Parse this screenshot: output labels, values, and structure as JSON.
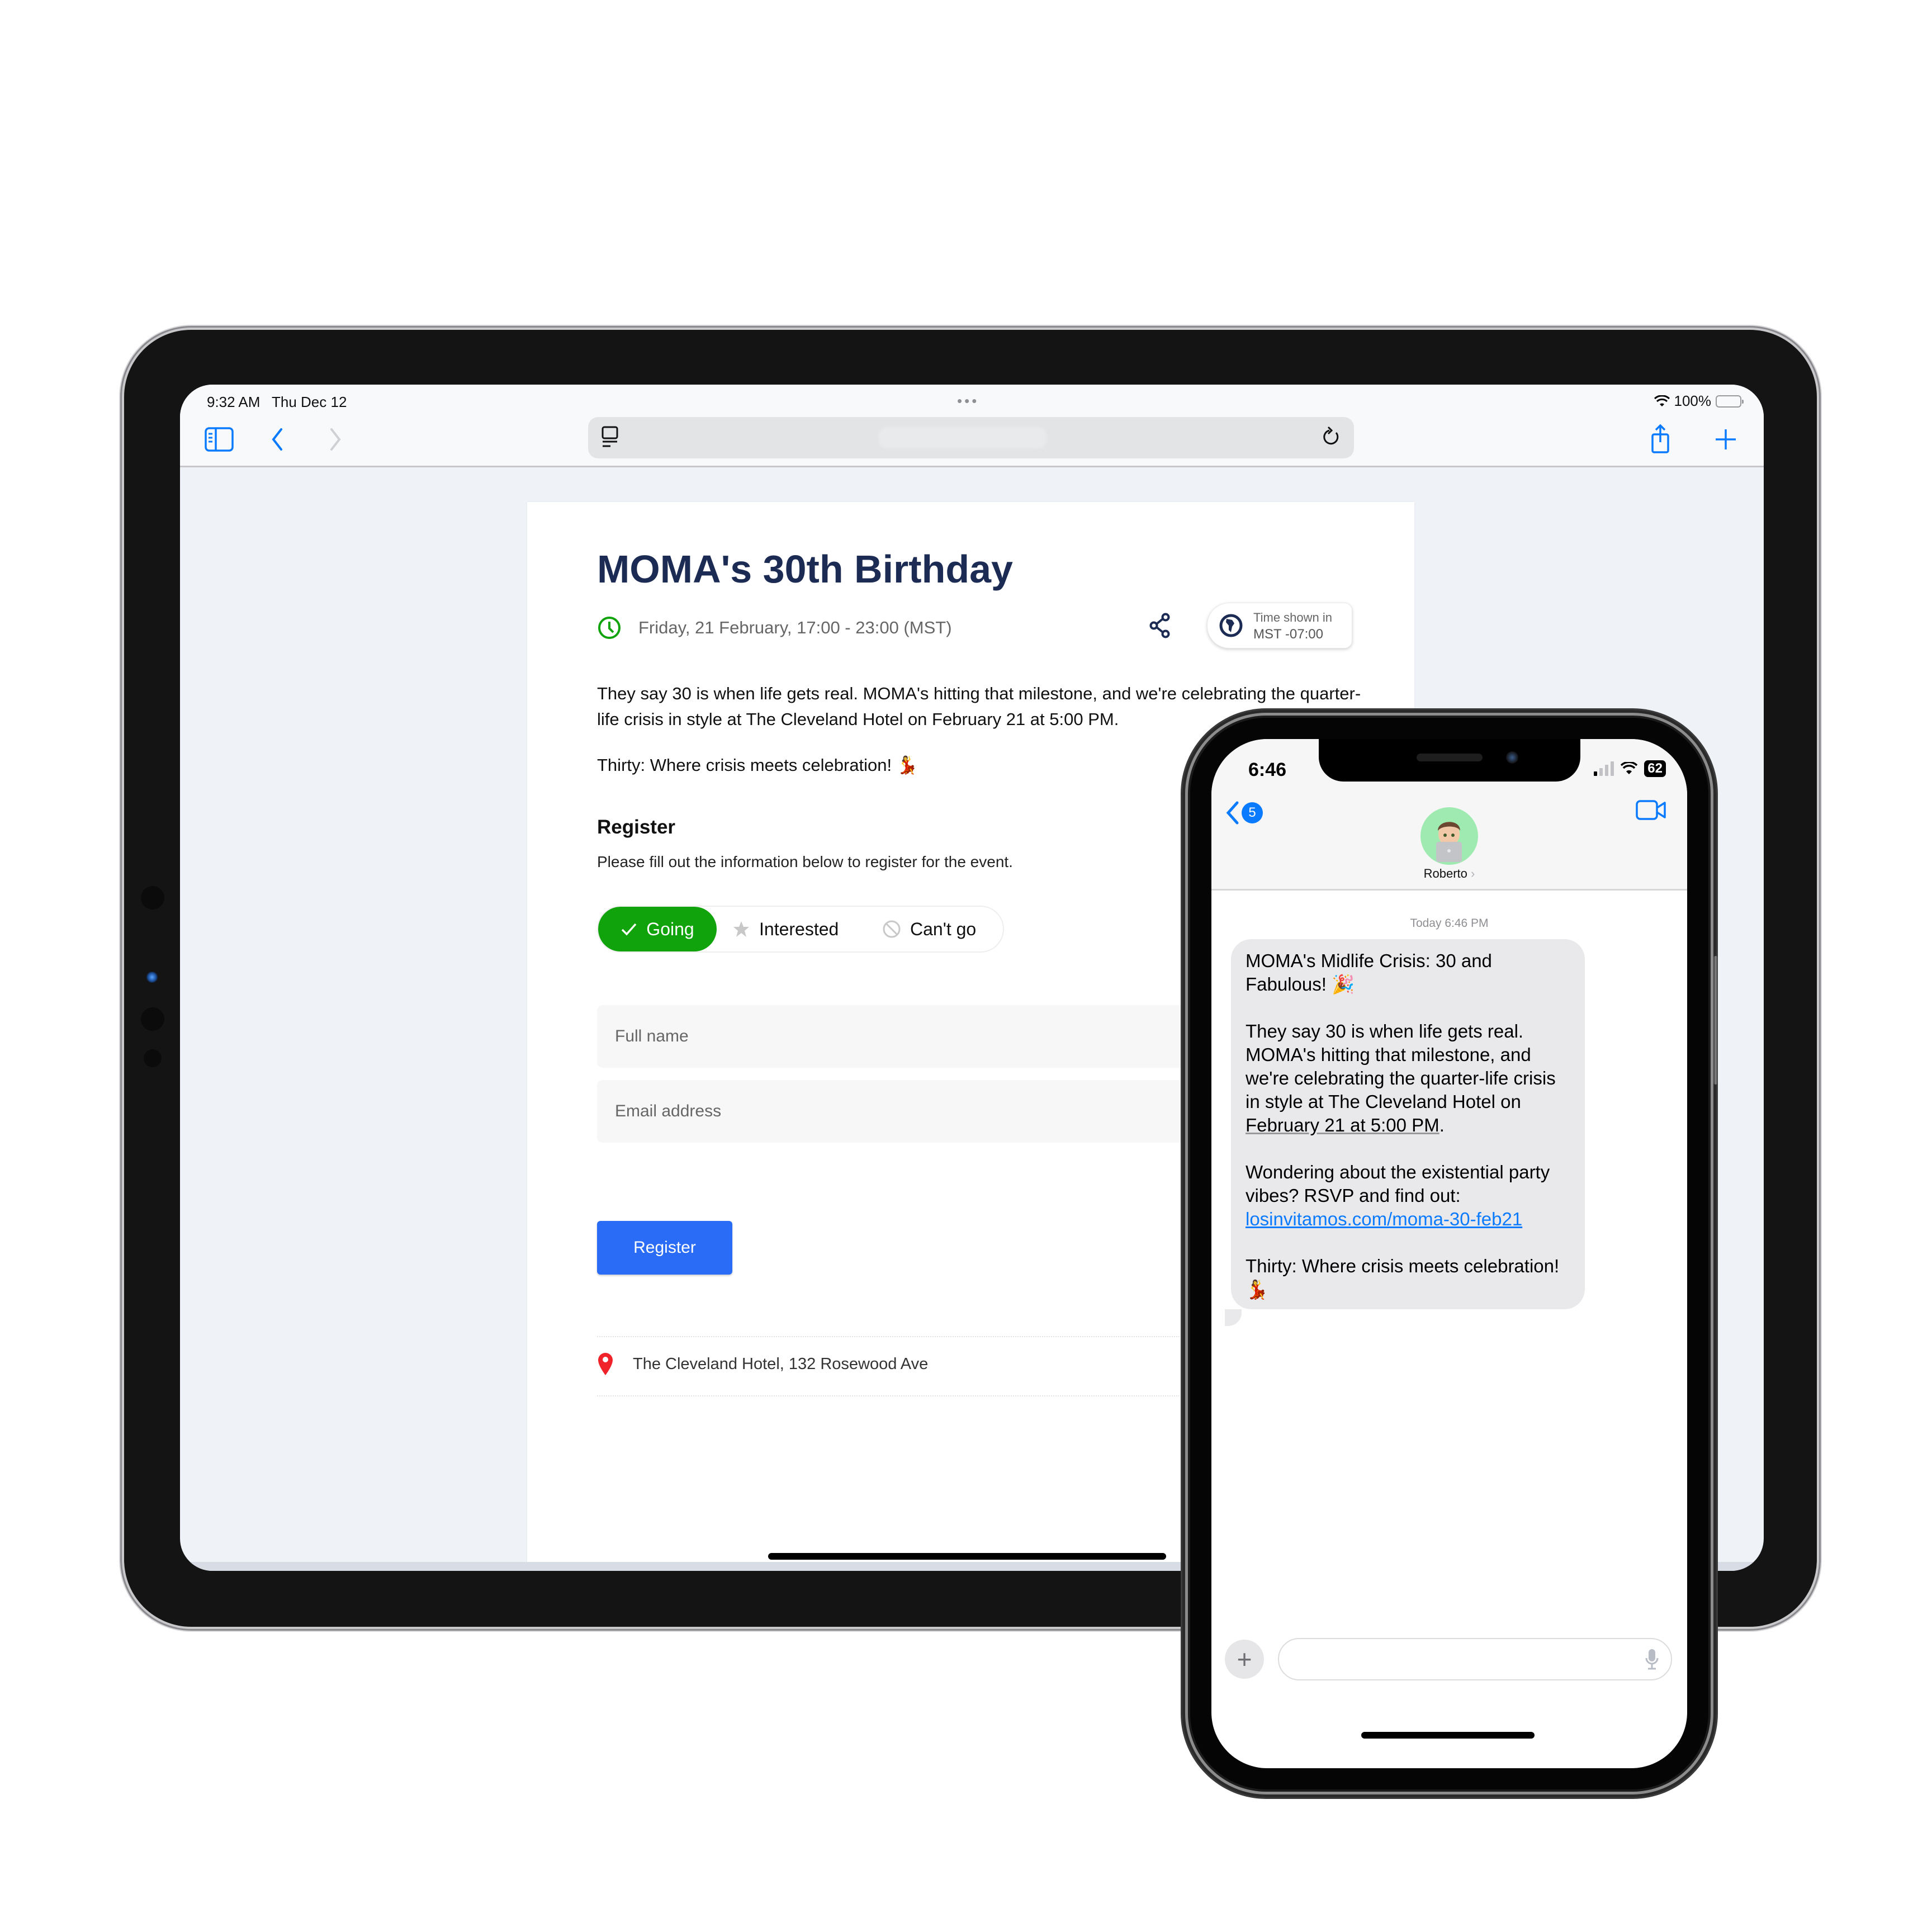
{
  "ipad": {
    "status": {
      "time": "9:32 AM",
      "date": "Thu Dec 12",
      "battery": "100%",
      "battery_level": 1.0
    },
    "toolbar": {
      "sidebar_icon": "sidebar-icon",
      "back_icon": "chevron-left-icon",
      "forward_icon": "chevron-right-icon",
      "reader_icon": "reader-mode-icon",
      "reload_icon": "reload-icon",
      "share_icon": "share-icon",
      "new_tab_icon": "plus-icon",
      "tabs_icon": "tabs-icon"
    },
    "event": {
      "title": "MOMA's 30th Birthday",
      "datetime": "Friday, 21 February, 17:00 - 23:00 (MST)",
      "timezone_label": "Time shown in",
      "timezone_value": "MST -07:00",
      "description": "They say 30 is when life gets real. MOMA's hitting that milestone, and we're celebrating the quarter-life crisis in style at The Cleveland Hotel on February 21 at 5:00 PM.",
      "tagline": "Thirty: Where crisis meets celebration! 💃",
      "register_heading": "Register",
      "register_subtitle": "Please fill out the information below to register for the event.",
      "rsvp_options": [
        {
          "label": "Going",
          "icon": "check-icon",
          "selected": true
        },
        {
          "label": "Interested",
          "icon": "star-icon",
          "selected": false
        },
        {
          "label": "Can't go",
          "icon": "prohibited-icon",
          "selected": false
        }
      ],
      "fields": {
        "full_name_placeholder": "Full name",
        "email_placeholder": "Email address"
      },
      "register_button": "Register",
      "location": "The Cleveland Hotel, 132 Rosewood Ave"
    },
    "colors": {
      "accent_green": "#11a30c",
      "button_blue": "#2b6cf6",
      "title_navy": "#1c2b53",
      "location_red": "#f0222a"
    }
  },
  "iphone": {
    "status": {
      "time": "6:46",
      "battery": "62"
    },
    "header": {
      "unread_count": "5",
      "contact_name": "Roberto",
      "contact_chevron": "›"
    },
    "timestamp": "Today 6:46 PM",
    "message": {
      "line1": "MOMA's Midlife Crisis: 30 and Fabulous! 🎉",
      "para2_before": "They say 30 is when life gets real. MOMA's hitting that milestone, and we're celebrating the quarter-life crisis in style at The Cleveland Hotel on ",
      "para2_date": "February 21 at 5:00 PM",
      "para2_after": ".",
      "para3": "Wondering about the existential party vibes? RSVP and find out:",
      "link": "losinvitamos.com/moma-30-feb21",
      "para4": "Thirty: Where crisis meets celebration! 💃"
    },
    "compose": {
      "plus_label": "+",
      "placeholder": ""
    },
    "colors": {
      "imessage_blue": "#0a7aff",
      "bubble_gray": "#e9e9eb",
      "avatar_bg": "#9eeab0"
    }
  }
}
